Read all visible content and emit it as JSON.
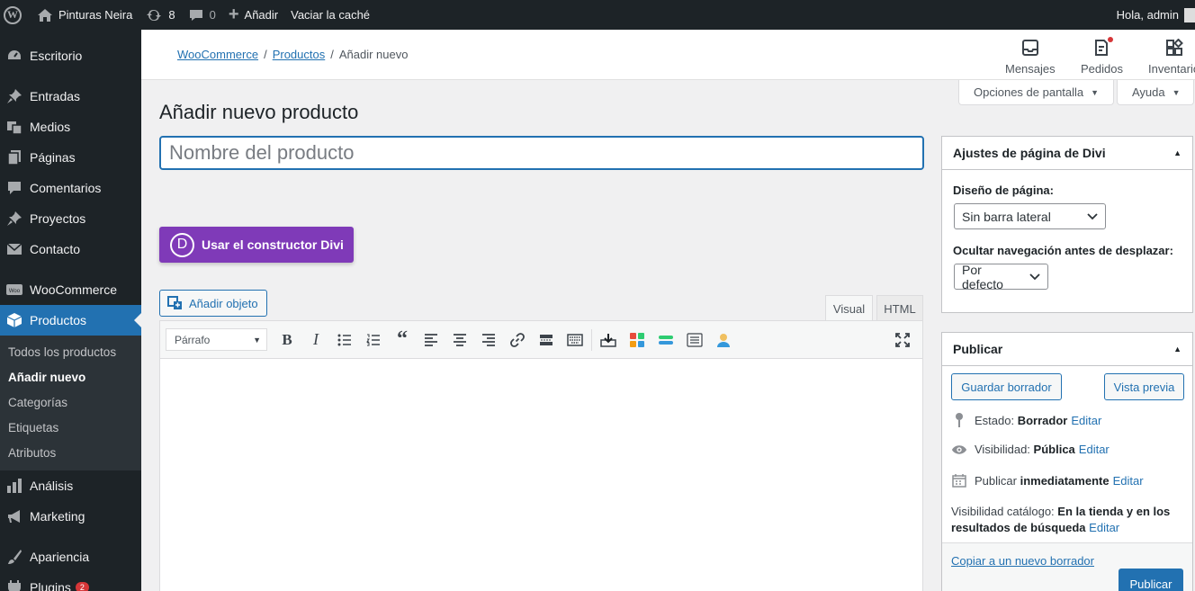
{
  "adminbar": {
    "site_name": "Pinturas Neira",
    "updates_count": "8",
    "comments_count": "0",
    "new_label": "Añadir",
    "clear_cache": "Vaciar la caché",
    "greeting": "Hola, admin"
  },
  "sidebar": {
    "items": [
      {
        "label": "Escritorio",
        "icon": "dashboard-icon"
      },
      {
        "label": "Entradas",
        "icon": "pin-icon"
      },
      {
        "label": "Medios",
        "icon": "media-icon"
      },
      {
        "label": "Páginas",
        "icon": "pages-icon"
      },
      {
        "label": "Comentarios",
        "icon": "comments-icon"
      },
      {
        "label": "Proyectos",
        "icon": "pin-icon"
      },
      {
        "label": "Contacto",
        "icon": "mail-icon"
      },
      {
        "label": "WooCommerce",
        "icon": "woo-icon"
      },
      {
        "label": "Productos",
        "icon": "box-icon"
      },
      {
        "label": "Análisis",
        "icon": "chart-icon"
      },
      {
        "label": "Marketing",
        "icon": "megaphone-icon"
      },
      {
        "label": "Apariencia",
        "icon": "brush-icon"
      },
      {
        "label": "Plugins",
        "icon": "plugin-icon"
      }
    ],
    "plugins_badge": "2",
    "submenu": [
      "Todos los productos",
      "Añadir nuevo",
      "Categorías",
      "Etiquetas",
      "Atributos"
    ]
  },
  "header": {
    "breadcrumb": [
      "WooCommerce",
      "Productos",
      "Añadir nuevo"
    ],
    "actions": [
      "Mensajes",
      "Pedidos",
      "Inventario"
    ]
  },
  "screen_options": {
    "options": "Opciones de pantalla",
    "help": "Ayuda"
  },
  "main": {
    "title": "Añadir nuevo producto",
    "name_placeholder": "Nombre del producto",
    "divi_button": "Usar el constructor Divi",
    "divi_logo": "D",
    "add_media": "Añadir objeto",
    "tab_visual": "Visual",
    "tab_html": "HTML",
    "format": "Párrafo"
  },
  "divi_box": {
    "title": "Ajustes de página de Divi",
    "layout_label": "Diseño de página:",
    "layout_value": "Sin barra lateral",
    "nav_label": "Ocultar navegación antes de desplazar:",
    "nav_value": "Por defecto"
  },
  "publish_box": {
    "title": "Publicar",
    "save_draft": "Guardar borrador",
    "preview": "Vista previa",
    "status_label": "Estado:",
    "status_value": "Borrador",
    "visibility_label": "Visibilidad:",
    "visibility_value": "Pública",
    "publish_label": "Publicar",
    "publish_value": "inmediatamente",
    "edit": "Editar",
    "catalog_label": "Visibilidad catálogo:",
    "catalog_value": "En la tienda y en los resultados de búsqueda",
    "copy_draft": "Copiar a un nuevo borrador",
    "publish_button": "Publicar"
  },
  "colors": {
    "accent": "#2271b1",
    "admin_bar": "#1d2327",
    "divi": "#7f3ab8"
  }
}
